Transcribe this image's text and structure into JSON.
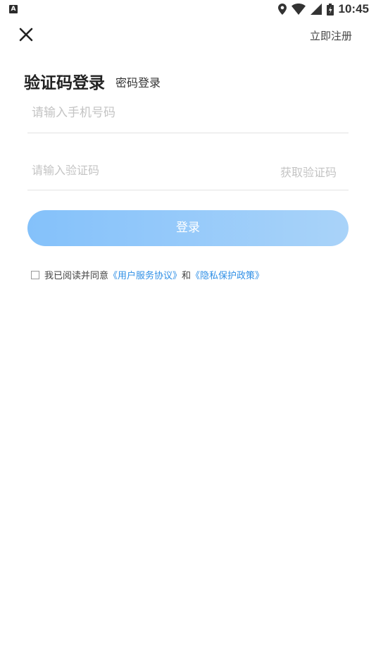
{
  "status_bar": {
    "time": "10:45",
    "left_icon": "A",
    "icons": [
      "location-icon",
      "wifi-icon",
      "signal-icon",
      "battery-icon"
    ]
  },
  "nav": {
    "close_icon": "close-icon",
    "register_label": "立即注册"
  },
  "tabs": {
    "active_label": "验证码登录",
    "inactive_label": "密码登录"
  },
  "form": {
    "phone_placeholder": "请输入手机号码",
    "phone_value": "",
    "code_placeholder": "请输入验证码",
    "code_value": "",
    "get_code_label": "获取验证码",
    "login_label": "登录"
  },
  "agreement": {
    "prefix": "我已阅读并同意",
    "user_agreement": "《用户服务协议》",
    "and": "和",
    "privacy_policy": "《隐私保护政策》",
    "checked": false
  },
  "colors": {
    "button_gradient_start": "#84c1fa",
    "button_gradient_end": "#a9d3f9",
    "link": "#2f8fe6",
    "placeholder": "#c4c4c4"
  }
}
